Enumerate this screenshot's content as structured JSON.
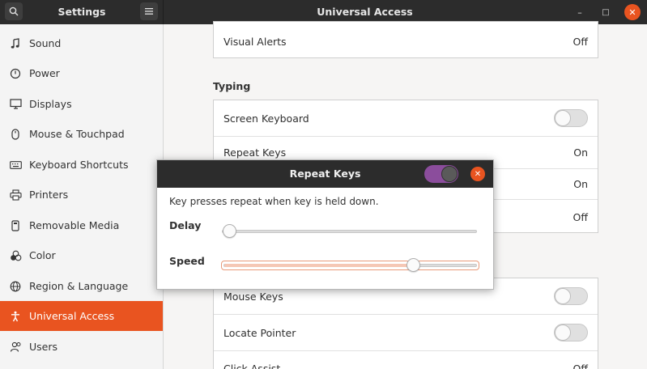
{
  "headerbar": {
    "sidebar_title": "Settings",
    "panel_title": "Universal Access",
    "search_icon": "search-icon",
    "menu_icon": "hamburger-menu-icon",
    "minimize_label": "–",
    "maximize_label": "□",
    "close_label": "✕"
  },
  "sidebar": {
    "items": [
      {
        "label": "Sound",
        "icon": "music-note-icon"
      },
      {
        "label": "Power",
        "icon": "power-icon"
      },
      {
        "label": "Displays",
        "icon": "display-icon"
      },
      {
        "label": "Mouse & Touchpad",
        "icon": "mouse-icon"
      },
      {
        "label": "Keyboard Shortcuts",
        "icon": "keyboard-icon"
      },
      {
        "label": "Printers",
        "icon": "printer-icon"
      },
      {
        "label": "Removable Media",
        "icon": "removable-media-icon"
      },
      {
        "label": "Color",
        "icon": "color-icon"
      },
      {
        "label": "Region & Language",
        "icon": "globe-icon"
      },
      {
        "label": "Universal Access",
        "icon": "accessibility-icon",
        "active": true
      },
      {
        "label": "Users",
        "icon": "users-icon"
      }
    ]
  },
  "main": {
    "visual_alerts": {
      "label": "Visual Alerts",
      "value": "Off"
    },
    "typing_title": "Typing",
    "typing_rows": {
      "screen_keyboard": "Screen Keyboard",
      "repeat_keys": {
        "label": "Repeat Keys",
        "value": "On"
      },
      "row3_value": "On",
      "row4_value": "Off"
    },
    "pointing_rows": {
      "mouse_keys": "Mouse Keys",
      "locate_pointer": "Locate Pointer",
      "click_assist": {
        "label": "Click Assist",
        "value": "Off"
      }
    }
  },
  "dialog": {
    "title": "Repeat Keys",
    "close_label": "✕",
    "description": "Key presses repeat when key is held down.",
    "delay_label": "Delay",
    "speed_label": "Speed",
    "delay_value": 0.0,
    "speed_value": 0.76,
    "accent": "#e95420",
    "switch_on_color": "#8b4d9c"
  }
}
